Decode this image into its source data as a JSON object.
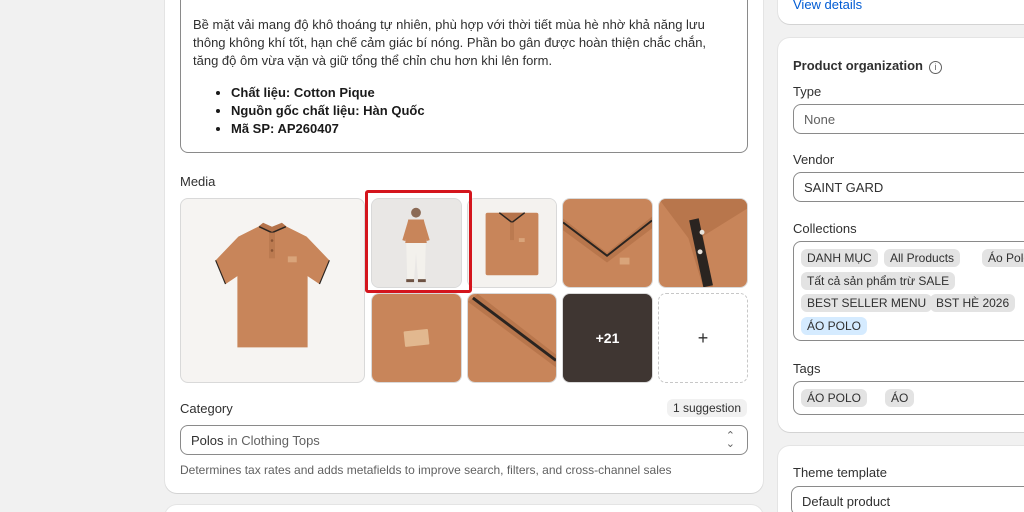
{
  "description": {
    "paragraph": "Bề mặt vải mang độ khô thoáng tự nhiên, phù hợp với thời tiết mùa hè nhờ khả năng lưu thông không khí tốt, hạn chế cảm giác bí nóng. Phần bo gân được hoàn thiện chắc chắn, tăng độ ôm vừa vặn và giữ tổng thể chỉn chu hơn khi lên form.",
    "bullets": [
      "Chất liệu: Cotton Pique",
      "Nguồn gốc chất liệu: Hàn Quốc",
      "Mã SP: AP260407"
    ]
  },
  "media": {
    "label": "Media",
    "more_count": "+21",
    "add_symbol": "+"
  },
  "category": {
    "label": "Category",
    "suggestion": "1 suggestion",
    "value": "Polos",
    "in_text": "in Clothing Tops",
    "help": "Determines tax rates and adds metafields to improve search, filters, and cross-channel sales"
  },
  "top_right": {
    "link": "View details"
  },
  "organization": {
    "title": "Product organization",
    "info_icon": "i",
    "type_label": "Type",
    "type_value": "None",
    "vendor_label": "Vendor",
    "vendor_value": "SAINT GARD",
    "collections_label": "Collections",
    "collections": [
      "DANH MỤC",
      "All Products",
      "Áo Polo",
      "Tất cả sản phẩm trừ SALE",
      "BEST SELLER MENU",
      "BST HÈ 2026",
      "ÁO POLO"
    ],
    "tags_label": "Tags",
    "tags": [
      "ÁO POLO",
      "ÁO"
    ]
  },
  "theme": {
    "title": "Theme template",
    "value": "Default product"
  },
  "colors": {
    "accent": "#005bd3",
    "highlight_border": "#d4151d",
    "polo": "#c8855a",
    "collar_stripe": "#2a2420"
  },
  "icons": {
    "select_chevron": "chevron-updown-icon",
    "info": "info-icon"
  }
}
